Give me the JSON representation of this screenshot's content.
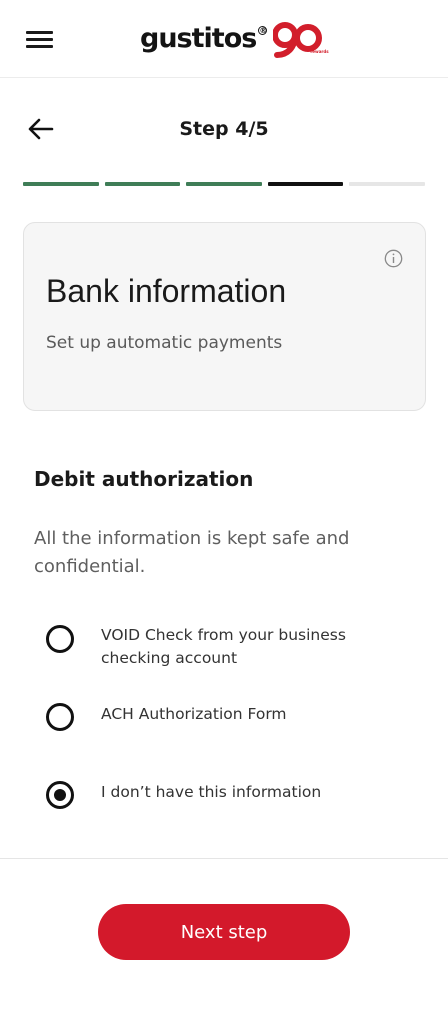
{
  "header": {
    "menu_icon": "hamburger-menu-icon",
    "logo_text": "gustitos",
    "logo_badge_number": "90",
    "logo_badge_caption": "rewards",
    "brand_color": "#d21e2b"
  },
  "step": {
    "title": "Step 4/5",
    "back_icon": "arrow-left-icon",
    "current": 4,
    "total": 5,
    "colors": {
      "done": "#3f7d57",
      "current": "#111111",
      "pending": "#e6e6e6"
    }
  },
  "card": {
    "title": "Bank information",
    "subtitle": "Set up automatic payments",
    "info_icon": "info-icon"
  },
  "section": {
    "title": "Debit authorization",
    "description": "All the information is kept safe and confidential."
  },
  "options": [
    {
      "label": "VOID Check from your business checking account",
      "checked": false
    },
    {
      "label": "ACH Authorization Form",
      "checked": false
    },
    {
      "label": "I don’t have this information",
      "checked": true
    }
  ],
  "footer": {
    "next_label": "Next step",
    "button_color": "#d3192b"
  }
}
